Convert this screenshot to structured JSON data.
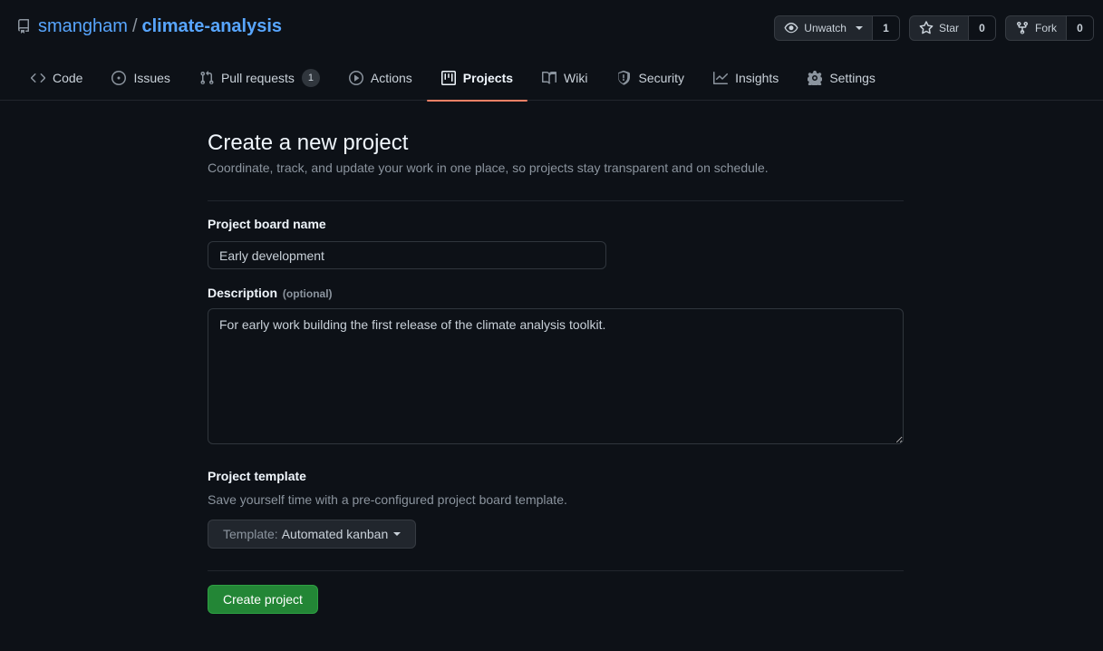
{
  "repo": {
    "owner": "smangham",
    "separator": "/",
    "name": "climate-analysis"
  },
  "actions": {
    "watch": {
      "label": "Unwatch",
      "count": "1"
    },
    "star": {
      "label": "Star",
      "count": "0"
    },
    "fork": {
      "label": "Fork",
      "count": "0"
    }
  },
  "tabs": [
    {
      "label": "Code",
      "icon": "code-icon"
    },
    {
      "label": "Issues",
      "icon": "issue-icon"
    },
    {
      "label": "Pull requests",
      "icon": "pull-request-icon",
      "count": "1"
    },
    {
      "label": "Actions",
      "icon": "play-icon"
    },
    {
      "label": "Projects",
      "icon": "project-icon",
      "active": true
    },
    {
      "label": "Wiki",
      "icon": "book-icon"
    },
    {
      "label": "Security",
      "icon": "shield-icon"
    },
    {
      "label": "Insights",
      "icon": "graph-icon"
    },
    {
      "label": "Settings",
      "icon": "gear-icon"
    }
  ],
  "form": {
    "title": "Create a new project",
    "subtitle": "Coordinate, track, and update your work in one place, so projects stay transparent and on schedule.",
    "name_label": "Project board name",
    "name_value": "Early development",
    "description_label": "Description",
    "description_optional": "(optional)",
    "description_value": "For early work building the first release of the climate analysis toolkit.",
    "template_label": "Project template",
    "template_note": "Save yourself time with a pre-configured project board template.",
    "template_prefix": "Template:",
    "template_value": "Automated kanban",
    "submit_label": "Create project"
  },
  "colors": {
    "background": "#0d1117",
    "accent_link": "#58a6ff",
    "active_tab_underline": "#f78166",
    "primary_button": "#238636"
  }
}
